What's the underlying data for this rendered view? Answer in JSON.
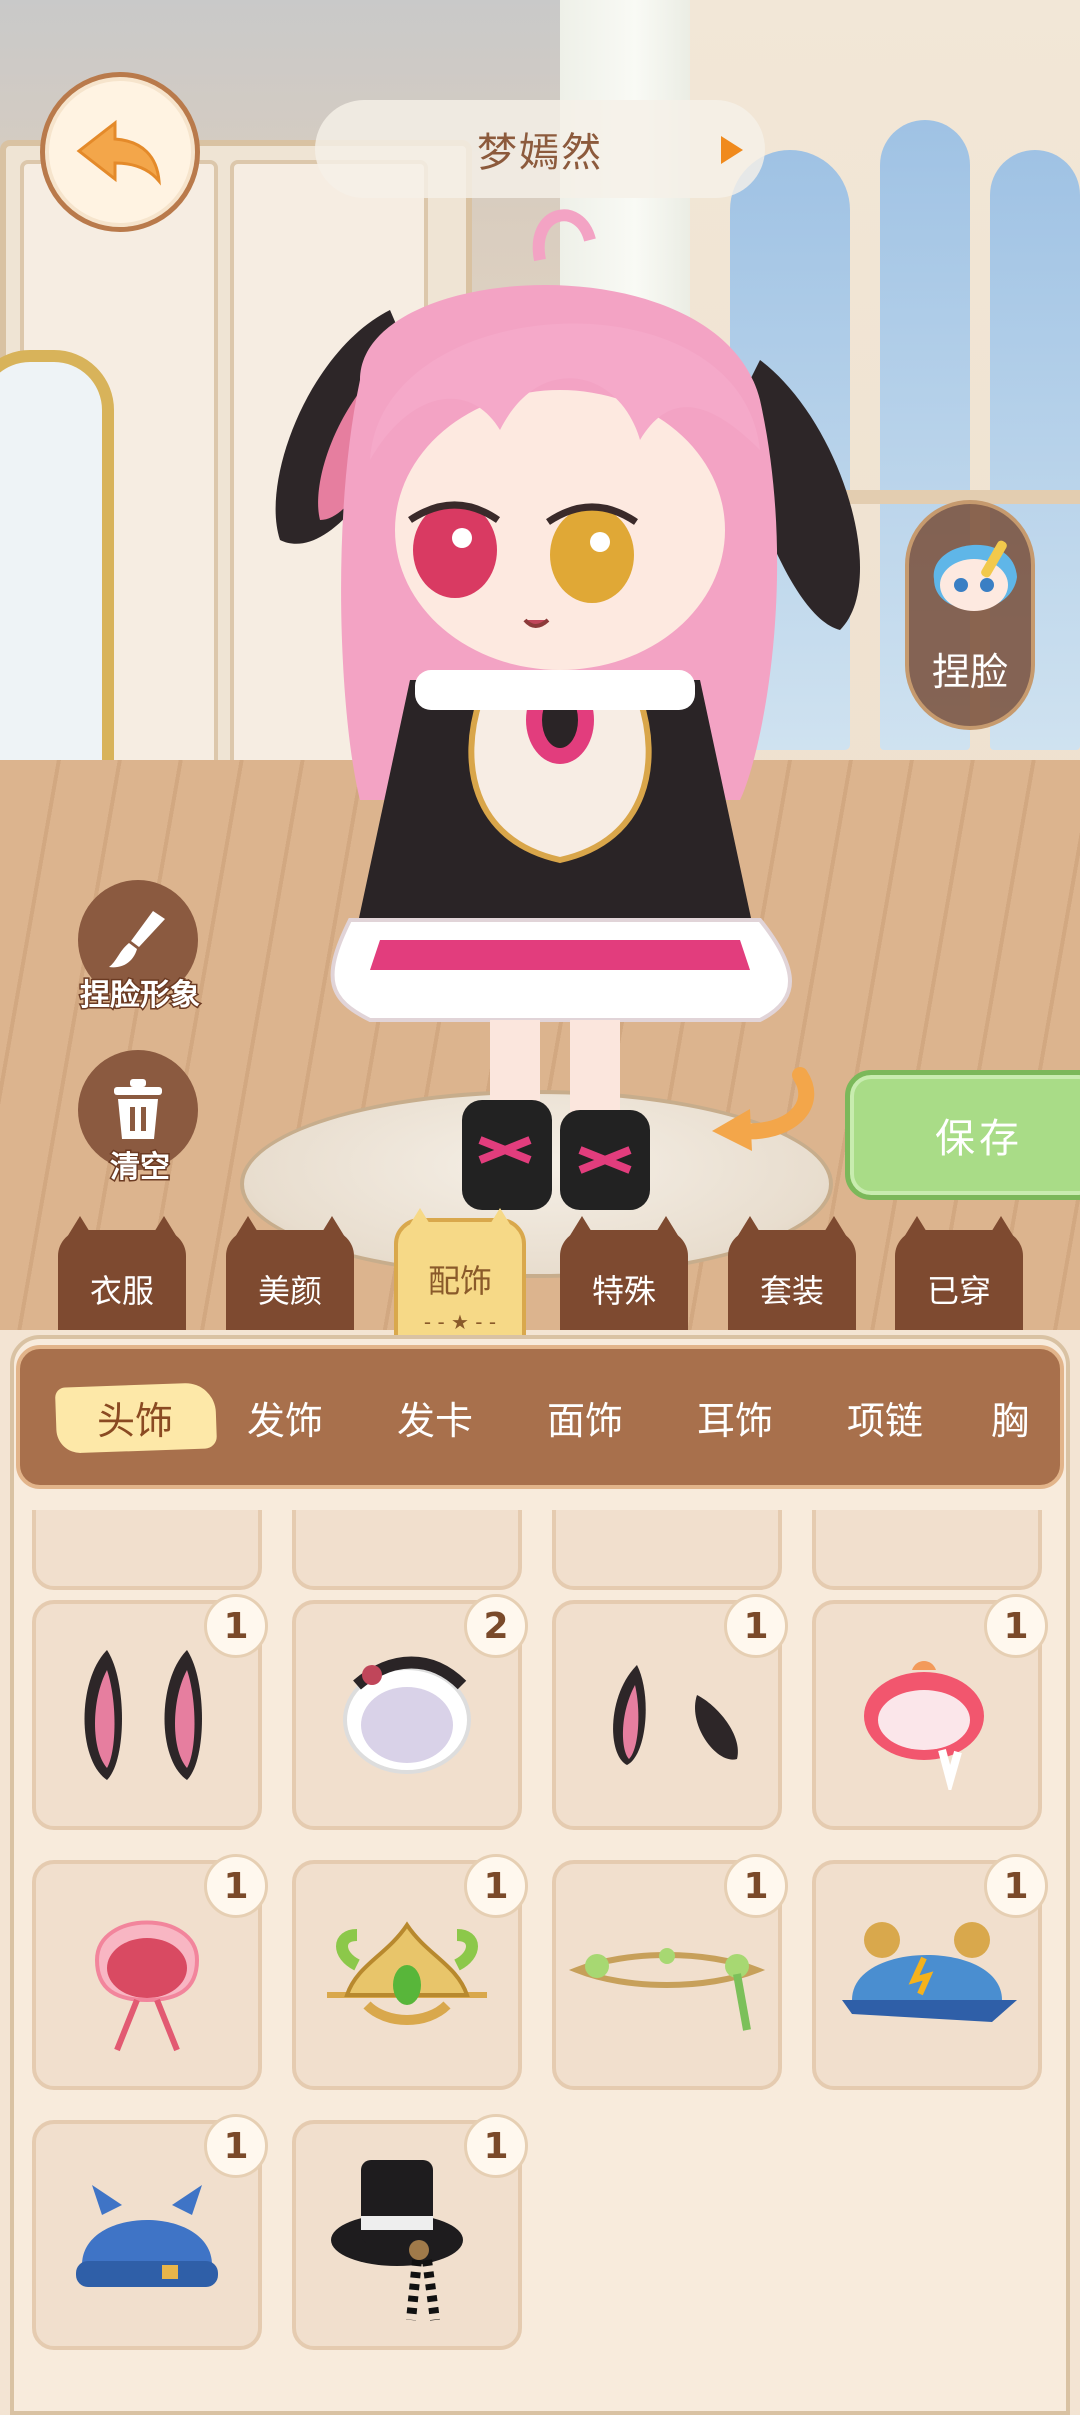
{
  "header": {
    "character_name": "梦嫣然"
  },
  "side_buttons": {
    "face_label": "捏脸",
    "face_image_label": "捏脸形象",
    "clear_label": "清空",
    "save_label": "保存"
  },
  "categories": [
    {
      "label": "衣服"
    },
    {
      "label": "美颜"
    },
    {
      "label": "配饰",
      "active": true
    },
    {
      "label": "特殊"
    },
    {
      "label": "套装"
    },
    {
      "label": "已穿"
    }
  ],
  "subtabs": [
    {
      "label": "头饰",
      "active": true
    },
    {
      "label": "发饰"
    },
    {
      "label": "发卡"
    },
    {
      "label": "面饰"
    },
    {
      "label": "耳饰"
    },
    {
      "label": "项链"
    },
    {
      "label": "胸"
    }
  ],
  "items": [
    {
      "icon": "partial-item-icon",
      "count": ""
    },
    {
      "icon": "partial-item-icon",
      "count": ""
    },
    {
      "icon": "partial-item-icon",
      "count": ""
    },
    {
      "icon": "partial-item-icon",
      "count": ""
    },
    {
      "icon": "black-bunny-ears-icon",
      "count": "1"
    },
    {
      "icon": "lace-bonnet-icon",
      "count": "2"
    },
    {
      "icon": "small-bunny-ears-icon",
      "count": "1"
    },
    {
      "icon": "strawberry-hat-icon",
      "count": "1"
    },
    {
      "icon": "pink-bonnet-icon",
      "count": "1"
    },
    {
      "icon": "golden-laurel-crown-icon",
      "count": "1"
    },
    {
      "icon": "vine-circlet-icon",
      "count": "1"
    },
    {
      "icon": "bear-ear-cap-icon",
      "count": "1"
    },
    {
      "icon": "blue-cat-beanie-icon",
      "count": "1"
    },
    {
      "icon": "checkered-top-hat-icon",
      "count": "1"
    }
  ],
  "colors": {
    "accent": "#a8704c",
    "save_green": "#a9dc87",
    "active_tab": "#f6d987"
  }
}
